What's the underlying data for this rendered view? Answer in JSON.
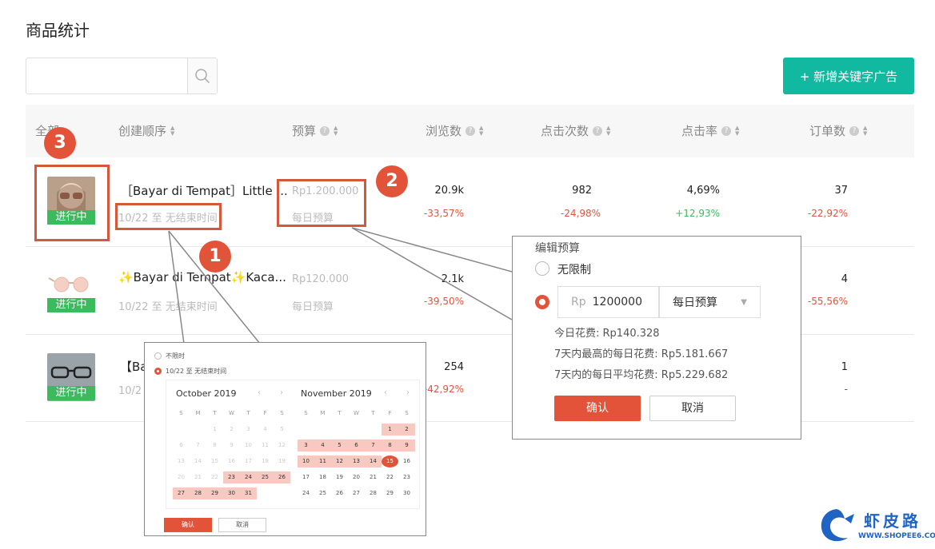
{
  "page": {
    "title": "商品统计"
  },
  "search": {
    "value": "",
    "placeholder": ""
  },
  "actions": {
    "add_keyword_ad": "+ 新增关键字广告"
  },
  "table": {
    "headers": {
      "all": "全部",
      "created_order": "创建顺序",
      "budget": "预算",
      "views": "浏览数",
      "clicks": "点击次数",
      "ctr": "点击率",
      "orders": "订单数"
    },
    "rows": [
      {
        "status": "进行中",
        "name": "［Bayar di Tempat］Little ...",
        "date_range": "10/22 至 无结束时间",
        "budget": "Rp1.200.000",
        "budget_type": "每日预算",
        "views": "20.9k",
        "views_delta": "-33,57%",
        "clicks": "982",
        "clicks_delta": "-24,98%",
        "ctr": "4,69%",
        "ctr_delta": "+12,93%",
        "orders": "37",
        "orders_delta": "-22,92%"
      },
      {
        "status": "进行中",
        "name": "✨Bayar di Tempat✨Kaca...",
        "date_range": "10/22 至 无结束时间",
        "budget": "Rp120.000",
        "budget_type": "每日预算",
        "views": "2.1k",
        "views_delta": "-39,50%",
        "orders": "4",
        "orders_delta": "-55,56%"
      },
      {
        "status": "进行中",
        "name": "【Ba",
        "date_range": "10/2",
        "views": "254",
        "views_delta": "-42,92%",
        "orders": "1",
        "orders_delta": "-"
      }
    ]
  },
  "badges": {
    "one": "1",
    "two": "2",
    "three": "3"
  },
  "budget_editor": {
    "title": "编辑预算",
    "unlimited": "无限制",
    "currency": "Rp",
    "amount": "1200000",
    "type": "每日预算",
    "today_spend": "今日花费: Rp140.328",
    "max_daily_7d": "7天内最高的每日花费: Rp5.181.667",
    "avg_daily_7d": "7天内的每日平均花费: Rp5.229.682",
    "confirm": "确认",
    "cancel": "取消"
  },
  "date_picker": {
    "option_unlimited": "不限时",
    "option_range": "10/22 至 无结束时间",
    "left_month": "October 2019",
    "right_month": "November 2019",
    "weekdays": [
      "S",
      "M",
      "T",
      "W",
      "T",
      "F",
      "S"
    ],
    "confirm": "确认",
    "cancel": "取消"
  },
  "watermark": {
    "text": "虾皮路",
    "url": "WWW.SHOPEE6.COM"
  },
  "colors": {
    "accent": "#e2533a",
    "primary": "#12b9a1",
    "success": "#3cba5e"
  }
}
